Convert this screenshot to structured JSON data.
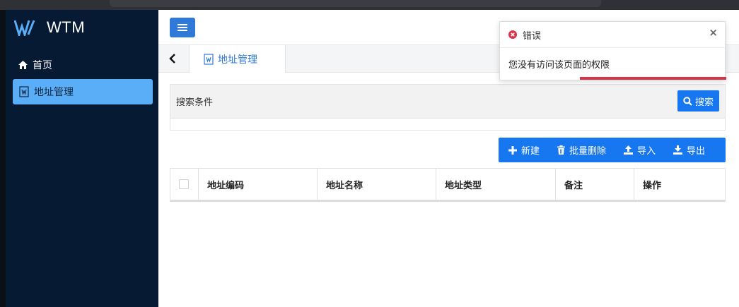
{
  "brand": {
    "name": "WTM"
  },
  "sidebar": {
    "items": [
      {
        "label": "首页",
        "icon": "home-icon"
      },
      {
        "label": "地址管理",
        "icon": "app-icon"
      }
    ]
  },
  "tabs": {
    "active_label": "地址管理"
  },
  "search": {
    "title": "搜索条件",
    "button_label": "搜索"
  },
  "actions": {
    "new_label": "新建",
    "batch_delete_label": "批量删除",
    "import_label": "导入",
    "export_label": "导出"
  },
  "table": {
    "columns": [
      "地址编码",
      "地址名称",
      "地址类型",
      "备注",
      "操作"
    ]
  },
  "toast": {
    "title": "错误",
    "message": "您没有访问该页面的权限",
    "close_label": "×"
  },
  "colors": {
    "sidebar_bg": "#071a33",
    "active_item": "#5aaef7",
    "primary": "#1677f0",
    "error": "#d9334a"
  }
}
